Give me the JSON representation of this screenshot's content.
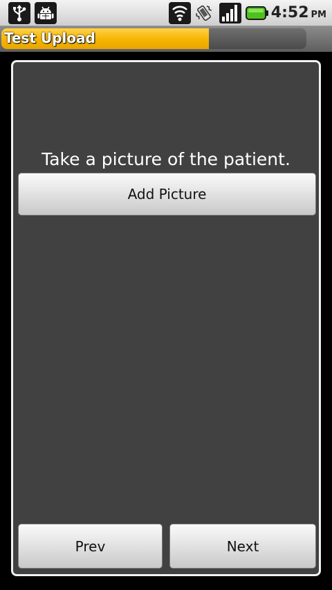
{
  "status_bar": {
    "icons": [
      "usb-icon",
      "android-debug-icon",
      "wifi-icon",
      "vibrate-icon",
      "signal-icon",
      "battery-icon"
    ],
    "time": "4:52",
    "ampm": "PM",
    "battery_color": "#4cc21a"
  },
  "app": {
    "title": "Test Upload",
    "progress": 0.68,
    "progress_color": "#f5b400"
  },
  "form": {
    "prompt": "Take a picture of the patient.",
    "add_picture_label": "Add Picture",
    "prev_label": "Prev",
    "next_label": "Next"
  }
}
